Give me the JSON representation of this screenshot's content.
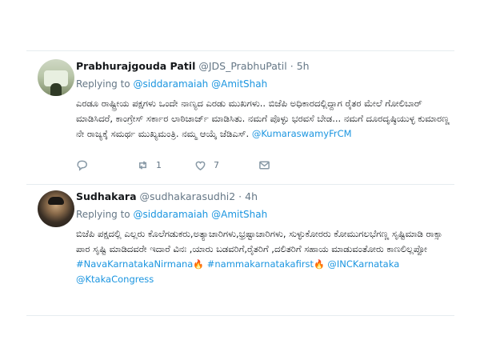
{
  "tweets": [
    {
      "name": "Prabhurajgouda Patil",
      "handle": "@JDS_PrabhuPatil",
      "separator": "·",
      "time": "5h",
      "replying_prefix": "Replying to",
      "replying_to": [
        "@siddaramaiah",
        "@AmitShah"
      ],
      "text": "ಎರಡೂ ರಾಷ್ಟ್ರೀಯ ಪಕ್ಷಗಳು ಒಂದೇ ನಾಣ್ಯದ ಎರಡು ಮುಖಗಳು.. ಬಿಜೆಪಿ ಅಧಿಕಾರದಲ್ಲಿದ್ದಾಗ ರೈತರ ಮೇಲೆ ಗೋಲಿಬಾರ್ ಮಾಡಿಸಿದರೆ, ಕಾಂಗ್ರೇಸ್ ಸರ್ಕಾರ ಲಾಠಿಚಾರ್ಜ್ ಮಾಡಿಸಿತು. ನಮಗೆ ಪೊಳ್ಳು ಭರವಸೆ ಬೇಡ... ನಮಗೆ ದೂರದೃಷ್ಠಿಯುಳ್ಳ ಕುಮಾರಣ್ಣ ನೇ ರಾಜ್ಯಕ್ಕೆ ಸಮರ್ಥ ಮುಖ್ಯಮಂತ್ರಿ. ನಮ್ಮ ಆಯ್ಕೆ ಜೆಡಿಎಸ್.",
      "mention": "@KumaraswamyFrCM",
      "retweets": "1",
      "likes": "7"
    },
    {
      "name": "Sudhakara",
      "handle": "@sudhakarasudhi2",
      "separator": "·",
      "time": "4h",
      "replying_prefix": "Replying to",
      "replying_to": [
        "@siddaramaiah",
        "@AmitShah"
      ],
      "text": "ಬಿಜೆಪಿ ಪಕ್ಷದಲ್ಲಿ ಎಲ್ಲರು ಕೊಲೆಗಡುಕರು,ಅತ್ಯಾಚಾರಿಗಳು,ಭ್ರಷ್ಟಾಚಾರಿಗಳು, ಸುಳ್ಳುಕೋರರು ಕೋಮುಗಲಭೆಗಣ್ಣ ಸೃಷ್ಟಿಮಾಡಿ ರಾಕ್ಸಾ ಪಾರ ಸೃಷ್ಟಿ ಮಾಡಿದವರೇ ಇದಾರೆ ವಿನಃ ,ಯಾರು ಬಡವರಿಗೆ,ರೈತರಿಗೆ ,ದಲಿತರಿಗೆ ಸಹಾಯ ಮಾಡುವಂತೋರು ಕಾಣಲಿಲ್ಲಪ್ಪೋ",
      "hashtags": [
        "#NavaKarnatakaNirmana",
        "#nammakarnatakafirst",
        "@INCKarnataka",
        "@KtakaCongress"
      ]
    }
  ],
  "icons": {
    "reply": "reply-icon",
    "retweet": "retweet-icon",
    "like": "heart-icon",
    "dm": "envelope-icon",
    "fire": "fire-emoji"
  },
  "colors": {
    "link": "#1b95e0",
    "muted": "#657786",
    "text": "#14171a"
  }
}
